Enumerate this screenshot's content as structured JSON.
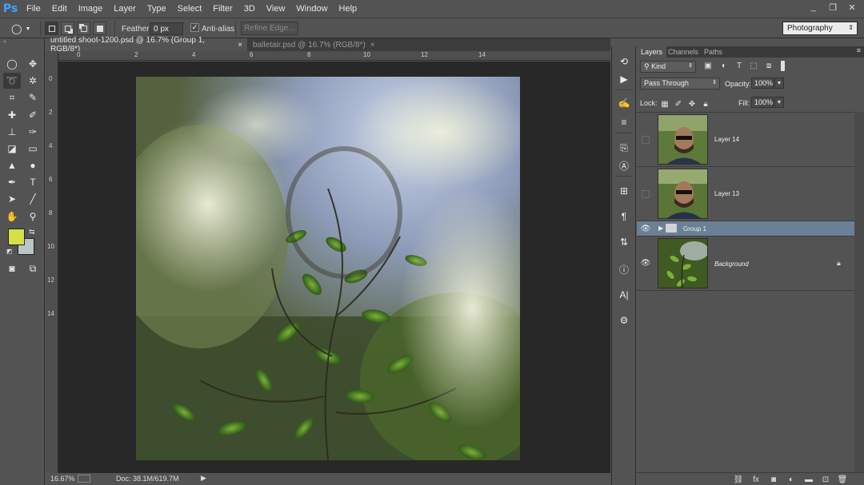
{
  "app": {
    "logo": "Ps",
    "menu": [
      "File",
      "Edit",
      "Image",
      "Layer",
      "Type",
      "Select",
      "Filter",
      "3D",
      "View",
      "Window",
      "Help"
    ],
    "window_controls": {
      "minimize": "_",
      "restore": "❐",
      "close": "✕"
    }
  },
  "options_bar": {
    "feather_label": "Feather:",
    "feather_value": "0 px",
    "antialias_label": "Anti-alias",
    "antialias_checked": true,
    "refine_edge_label": "Refine Edge...",
    "workspace": "Photography"
  },
  "document": {
    "tabs": [
      {
        "label": "untitled shoot-1200.psd @ 16.7% (Group 1, RGB/8*)",
        "close": "×",
        "active": true
      },
      {
        "label": "balletair.psd @ 16.7% (RGB/8*)",
        "close": "×",
        "active": false
      }
    ],
    "ruler_h": [
      "0",
      "2",
      "4",
      "6",
      "8",
      "10",
      "12",
      "14"
    ],
    "ruler_v": [
      "0",
      "2",
      "4",
      "6",
      "8",
      "10",
      "12",
      "14"
    ],
    "zoom": "16.67%",
    "doc_info": "Doc: 38.1M/619.7M"
  },
  "layers_panel": {
    "tabs": [
      "Layers",
      "Channels",
      "Paths"
    ],
    "filter_kind": "Kind",
    "blend_mode": "Pass Through",
    "opacity_label": "Opacity:",
    "opacity_value": "100%",
    "lock_label": "Lock:",
    "fill_label": "Fill:",
    "fill_value": "100%",
    "layers": [
      {
        "name": "Layer 14",
        "visible": false,
        "type": "portrait"
      },
      {
        "name": "Layer 13",
        "visible": false,
        "type": "portrait"
      },
      {
        "name": "Group 1",
        "visible": true,
        "type": "group",
        "selected": true
      },
      {
        "name": "Background",
        "visible": true,
        "type": "plant",
        "locked": true
      }
    ]
  },
  "colors": {
    "foreground": "#d4e04a",
    "background": "#b8c6c4",
    "selection": "#6b7f95",
    "ps_blue": "#3ba4ff"
  }
}
